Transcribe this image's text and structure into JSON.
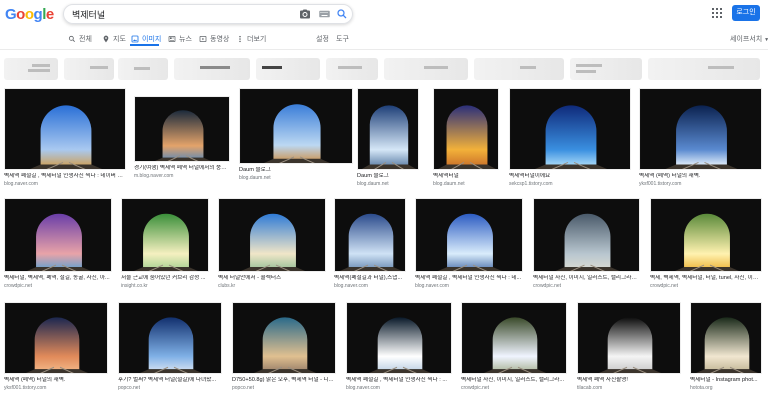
{
  "header": {
    "logo": [
      "G",
      "o",
      "o",
      "g",
      "l",
      "e"
    ],
    "logo_colors": [
      "#4285F4",
      "#EA4335",
      "#FBBC05",
      "#4285F4",
      "#34A853",
      "#EA4335"
    ],
    "search_value": "벽제터널",
    "login_label": "로그인"
  },
  "tabs": [
    {
      "label": "전체",
      "icon": "search-icon",
      "active": false
    },
    {
      "label": "지도",
      "icon": "map-pin-icon",
      "active": false
    },
    {
      "label": "이미지",
      "icon": "image-icon",
      "active": true
    },
    {
      "label": "뉴스",
      "icon": "news-icon",
      "active": false
    },
    {
      "label": "동영상",
      "icon": "video-icon",
      "active": false
    },
    {
      "label": "더보기",
      "icon": "more-icon",
      "active": false
    }
  ],
  "tools": {
    "settings": "설정",
    "tools": "도구"
  },
  "safesearch": "세이프서치",
  "colors": {
    "accent": "#1a73e8",
    "muted": "#5f6368",
    "source": "#70757a"
  },
  "results": [
    {
      "title": "벽제역 폐철길 , 벽제터널 인생사진 찍다 : 네이버 블로그",
      "source": "blog.naver.com"
    },
    {
      "title": "경기(여행) 벽제역 폐역 터널에서의 풍경...",
      "source": "m.blog.naver.com"
    },
    {
      "title": "Daum 블로그",
      "source": "blog.daum.net"
    },
    {
      "title": "Daum 블로그",
      "source": "blog.daum.net"
    },
    {
      "title": "벽제역터널",
      "source": "blog.daum.net"
    },
    {
      "title": "벽제역터널이에요",
      "source": "sekcsp1.tistory.com"
    },
    {
      "title": "벽제역 (폐역) 터널의 새벽.",
      "source": "yksf001.tistory.com"
    },
    {
      "title": "벽제터널, 벽제역, 폐역, 철길, 동굴, 사진, 아...",
      "source": "crowdpic.net"
    },
    {
      "title": "서울 근교에 숨어있던 커브리 감성 ...",
      "source": "insight.co.kr"
    },
    {
      "title": "벽제 터널안에서 - 콜렉터즈",
      "source": "clubs.kr"
    },
    {
      "title": "벽제역(폐철길과 터널),스냅...",
      "source": "blog.naver.com"
    },
    {
      "title": "벽제역 폐철길 , 벽제터널 인생사진 찍다 : 네...",
      "source": "blog.naver.com"
    },
    {
      "title": "벽제터널 사진, 이미지, 일러스트, 캘리그라피 ...",
      "source": "crowdpic.net"
    },
    {
      "title": "벽제, 벽제역, 벽제터널, 터널, tunel, 사진, 이미...",
      "source": "crowdpic.net"
    },
    {
      "title": "벽제역 (폐역) 터널의 새벽.",
      "source": "yksf001.tistory.com"
    },
    {
      "title": "후기? 벌써? 벽제역 터널(철길)에 다녀왔...",
      "source": "popco.net"
    },
    {
      "title": "D750+50.8g) 맑은 오후, 벽제역 터널 - 니...",
      "source": "popco.net"
    },
    {
      "title": "벽제역 폐철길 , 벽제터널 인생사진 찍다 : ...",
      "source": "blog.naver.com"
    },
    {
      "title": "벽제터널 사진, 이미지, 일러스트, 캘리그라...",
      "source": "crowdpic.net"
    },
    {
      "title": "벽제역 폐역 사진촬영!",
      "source": "tilacab.com"
    },
    {
      "title": "벽제터널 - Instagram phot...",
      "source": "hotota.org"
    }
  ]
}
